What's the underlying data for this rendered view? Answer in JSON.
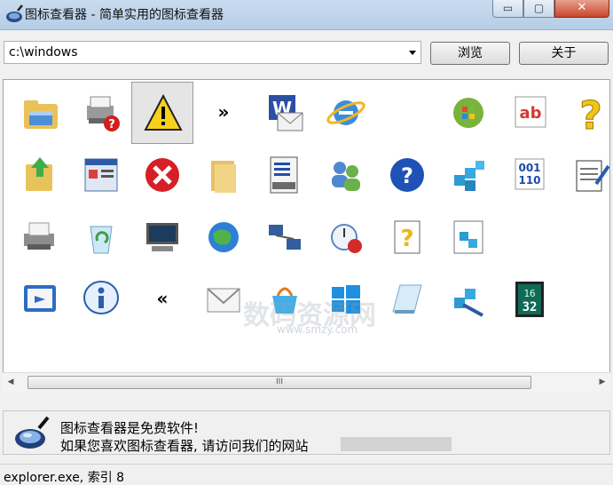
{
  "window": {
    "title": "图标查看器 - 简单实用的图标查看器",
    "minimize_glyph": "▭",
    "maximize_glyph": "▢",
    "close_glyph": "✕"
  },
  "toolbar": {
    "path_value": "c:\\windows",
    "browse_label": "浏览",
    "about_label": "关于"
  },
  "icons": [
    {
      "name": "explorer-folder-icon"
    },
    {
      "name": "printer-error-icon"
    },
    {
      "name": "warning-icon",
      "selected": true
    },
    {
      "name": "double-chevron-right-icon"
    },
    {
      "name": "word-document-mail-icon"
    },
    {
      "name": "internet-explorer-globe-icon"
    },
    {
      "name": "empty-slot"
    },
    {
      "name": "windows-orb-icon"
    },
    {
      "name": "ab-text-icon"
    },
    {
      "name": "help-question-icon"
    },
    {
      "name": "folder-up-arrow-icon"
    },
    {
      "name": "window-list-icon"
    },
    {
      "name": "error-x-icon"
    },
    {
      "name": "folder-icon"
    },
    {
      "name": "computer-list-icon"
    },
    {
      "name": "users-icon"
    },
    {
      "name": "help-circle-icon"
    },
    {
      "name": "registry-cubes-icon"
    },
    {
      "name": "binary-data-icon"
    },
    {
      "name": "notepad-pen-icon"
    },
    {
      "name": "printer-icon"
    },
    {
      "name": "recycle-bin-icon"
    },
    {
      "name": "terminal-computer-icon"
    },
    {
      "name": "globe-network-icon"
    },
    {
      "name": "network-computers-icon"
    },
    {
      "name": "clock-error-icon"
    },
    {
      "name": "help-document-icon"
    },
    {
      "name": "registry-document-icon"
    },
    {
      "name": "empty-slot"
    },
    {
      "name": "empty-slot"
    },
    {
      "name": "remote-desktop-icon"
    },
    {
      "name": "info-icon"
    },
    {
      "name": "double-chevron-left-icon"
    },
    {
      "name": "mail-envelope-icon"
    },
    {
      "name": "store-basket-icon"
    },
    {
      "name": "windows-logo-icon"
    },
    {
      "name": "notepad-icon"
    },
    {
      "name": "registry-tool-icon"
    },
    {
      "name": "digital-clock-icon"
    }
  ],
  "digital_clock": {
    "top": "16",
    "bottom": "32"
  },
  "ab_text": "ab",
  "binary_digits": {
    "row1": "001",
    "row2": "110"
  },
  "scrollbar": {
    "grip": "III",
    "left_arrow": "◀",
    "right_arrow": "▶"
  },
  "watermark": {
    "text": "数码资源网",
    "url": "www.smzy.com"
  },
  "info": {
    "line1": "图标查看器是免费软件!",
    "line2": "如果您喜欢图标查看器, 请访问我们的网站"
  },
  "status": {
    "text": "explorer.exe,  索引 8"
  },
  "colors": {
    "titlebar": "#c9dcef",
    "close_button": "#c9462c",
    "selection": "#e5e5e5",
    "panel_bg": "#ffffff"
  }
}
